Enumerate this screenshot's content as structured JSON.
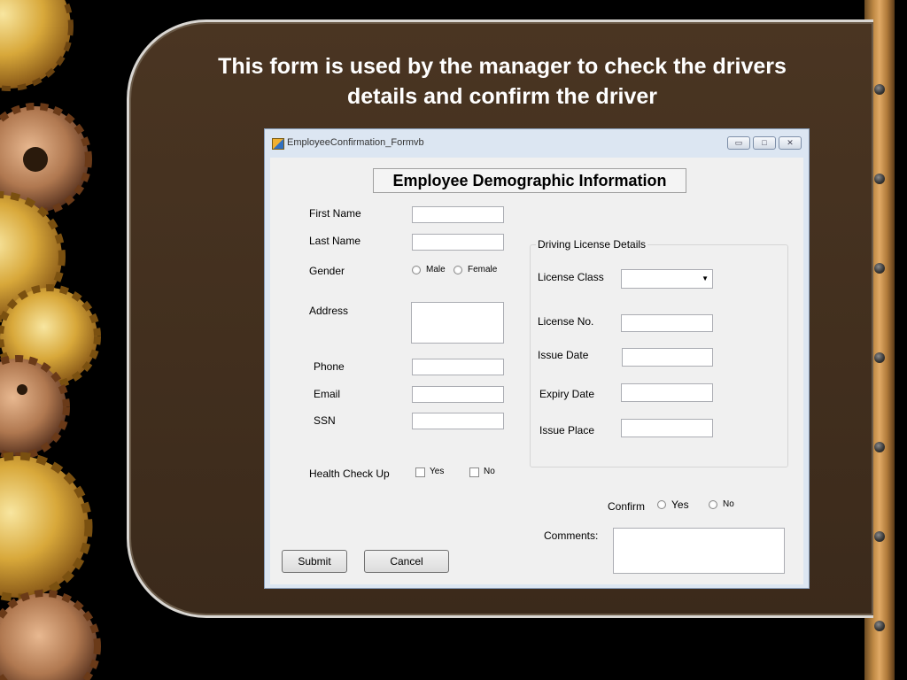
{
  "slide": {
    "title_line1": "This form is used by the manager to check the drivers",
    "title_line2": "details and confirm the driver"
  },
  "window": {
    "title": "EmployeeConfirmation_Formvb",
    "icons": [
      "app-icon",
      "minimize-icon",
      "maximize-icon",
      "close-icon"
    ]
  },
  "form": {
    "heading": "Employee Demographic Information",
    "first_name": {
      "label": "First Name",
      "value": ""
    },
    "last_name": {
      "label": "Last Name",
      "value": ""
    },
    "gender": {
      "label": "Gender",
      "options": [
        "Male",
        "Female"
      ],
      "selected": null
    },
    "address": {
      "label": "Address",
      "value": ""
    },
    "phone": {
      "label": "Phone",
      "value": ""
    },
    "email": {
      "label": "Email",
      "value": ""
    },
    "ssn": {
      "label": "SSN",
      "value": ""
    },
    "health_check": {
      "label": "Health Check Up",
      "yes": "Yes",
      "no": "No"
    },
    "license_group": {
      "title": "Driving License Details",
      "license_class": {
        "label": "License Class",
        "value": ""
      },
      "license_no": {
        "label": "License No.",
        "value": ""
      },
      "issue_date": {
        "label": "Issue Date",
        "value": ""
      },
      "expiry_date": {
        "label": "Expiry Date",
        "value": ""
      },
      "issue_place": {
        "label": "Issue Place",
        "value": ""
      }
    },
    "confirm": {
      "label": "Confirm",
      "yes": "Yes",
      "no": "No"
    },
    "comments": {
      "label": "Comments:",
      "value": ""
    },
    "submit_label": "Submit",
    "cancel_label": "Cancel"
  }
}
